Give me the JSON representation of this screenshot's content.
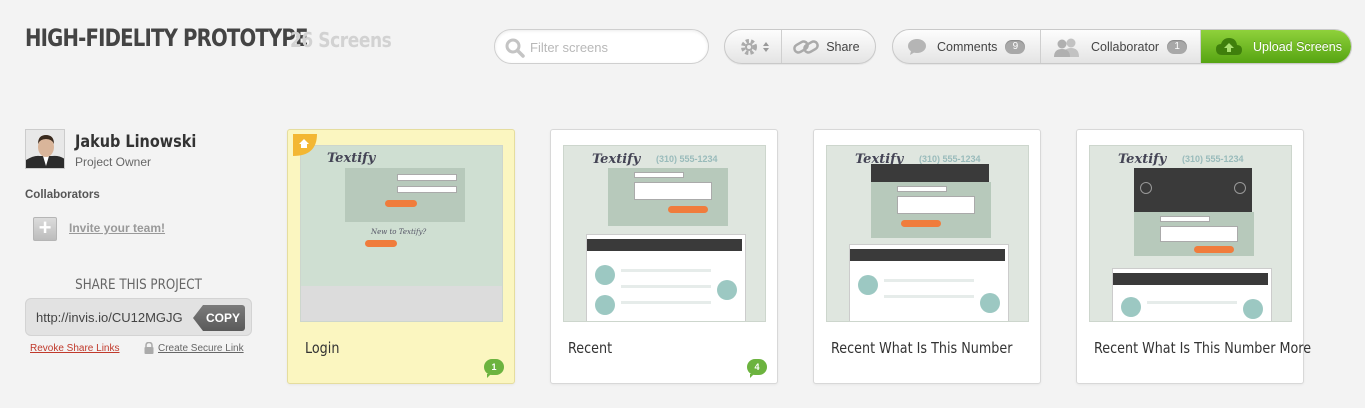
{
  "header": {
    "title": "HIGH-FIDELITY PROTOTYPE",
    "subtitle": "26 Screens",
    "search_placeholder": "Filter screens",
    "share_label": "Share",
    "comments_label": "Comments",
    "comments_count": "9",
    "collaborator_label": "Collaborator",
    "collaborator_count": "1",
    "upload_label": "Upload Screens"
  },
  "sidebar": {
    "owner_name": "Jakub Linowski",
    "owner_role": "Project Owner",
    "collaborators_label": "Collaborators",
    "invite_label": "Invite your team!",
    "share_title": "SHARE THIS PROJECT",
    "share_url": "http://invis.io/CU12MGJG",
    "copy_label": "COPY",
    "revoke_label": "Revoke Share Links",
    "secure_label": "Create Secure Link"
  },
  "screens": [
    {
      "name": "Login",
      "comments": "1",
      "is_home": true
    },
    {
      "name": "Recent",
      "comments": "4",
      "is_home": false
    },
    {
      "name": "Recent What Is This Number",
      "comments": "",
      "is_home": false
    },
    {
      "name": "Recent What Is This Number More",
      "comments": "",
      "is_home": false
    }
  ],
  "thumbnail": {
    "logo": "Textify",
    "phone": "(310) 555-1234",
    "new_to": "New to Textify?"
  },
  "colors": {
    "upload_green": "#6cb33f",
    "home_card": "#fbf6c0",
    "accent_orange": "#f07c3c"
  }
}
